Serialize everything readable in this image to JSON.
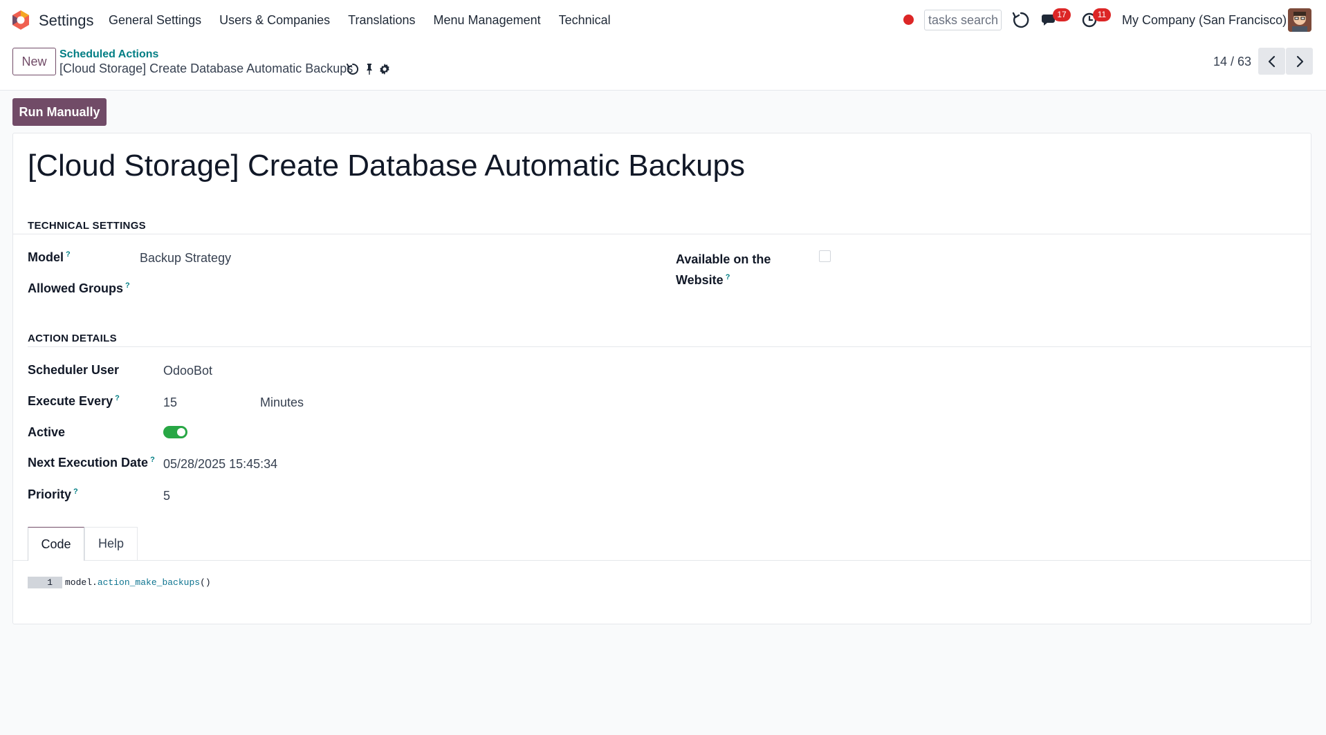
{
  "navbar": {
    "app_name": "Settings",
    "menu": [
      "General Settings",
      "Users & Companies",
      "Translations",
      "Menu Management",
      "Technical"
    ],
    "search_placeholder": "tasks search",
    "messages_badge": "17",
    "activities_badge": "11",
    "company": "My Company (San Francisco)"
  },
  "control_panel": {
    "new_label": "New",
    "breadcrumb_parent": "Scheduled Actions",
    "breadcrumb_current": "[Cloud Storage] Create Database Automatic Backups",
    "pager": "14 / 63"
  },
  "status_bar": {
    "run_label": "Run Manually"
  },
  "form": {
    "title": "[Cloud Storage] Create Database Automatic Backups",
    "technical_section": "TECHNICAL SETTINGS",
    "model_label": "Model",
    "model_value": "Backup Strategy",
    "allowed_groups_label": "Allowed Groups",
    "website_label_1": "Available on the",
    "website_label_2": "Website",
    "website_checked": false,
    "action_section": "ACTION DETAILS",
    "scheduler_user_label": "Scheduler User",
    "scheduler_user_value": "OdooBot",
    "execute_every_label": "Execute Every",
    "interval_number": "15",
    "interval_unit": "Minutes",
    "active_label": "Active",
    "active_value": true,
    "next_exec_label": "Next Execution Date",
    "next_exec_value": "05/28/2025 15:45:34",
    "priority_label": "Priority",
    "priority_value": "5",
    "help_mark": "?",
    "tabs": [
      "Code",
      "Help"
    ],
    "code": {
      "line_number": "1",
      "object": "model",
      "dot": ".",
      "method": "action_make_backups",
      "parens": "()"
    }
  },
  "colors": {
    "brand": "#714b67",
    "link": "#017e84",
    "toggle_on": "#28a745",
    "badge": "#dc2626"
  }
}
